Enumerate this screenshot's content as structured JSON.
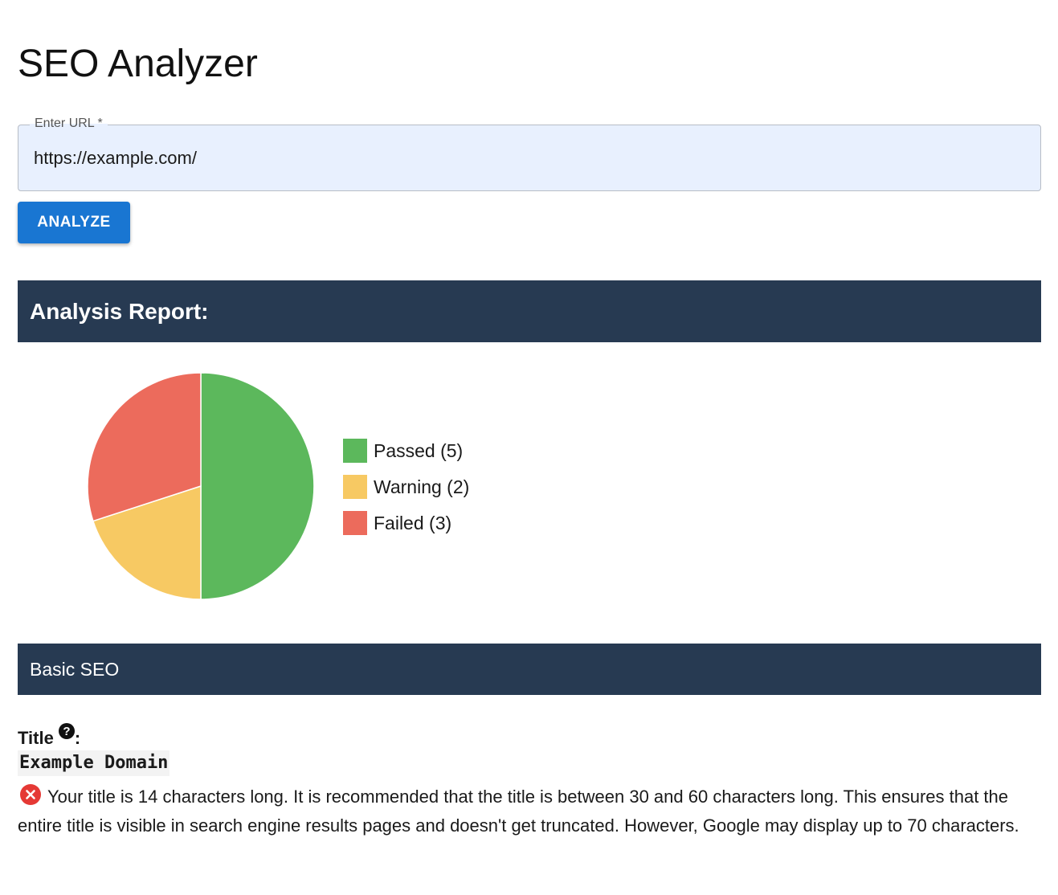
{
  "app": {
    "title": "SEO Analyzer"
  },
  "url_field": {
    "label": "Enter URL *",
    "value": "https://example.com/"
  },
  "analyze_button": {
    "label": "ANALYZE"
  },
  "report": {
    "heading": "Analysis Report:"
  },
  "chart_data": {
    "type": "pie",
    "slices": [
      {
        "name": "Passed",
        "value": 5,
        "color": "#5cb85c",
        "legend": "Passed (5)"
      },
      {
        "name": "Warning",
        "value": 2,
        "color": "#f7c963",
        "legend": "Warning (2)"
      },
      {
        "name": "Failed",
        "value": 3,
        "color": "#ec6b5c",
        "legend": "Failed (3)"
      }
    ],
    "legend_placement": "right"
  },
  "sections": {
    "basic_seo": {
      "heading": "Basic SEO",
      "title_check": {
        "label": "Title",
        "colon": ":",
        "help_icon": "question-circle-icon",
        "value": "Example Domain",
        "status_icon": "error-circle-icon",
        "status_color": "#e53935",
        "message": "Your title is 14 characters long. It is recommended that the title is between 30 and 60 characters long. This ensures that the entire title is visible in search engine results pages and doesn't get truncated. However, Google may display up to 70 characters."
      }
    }
  }
}
